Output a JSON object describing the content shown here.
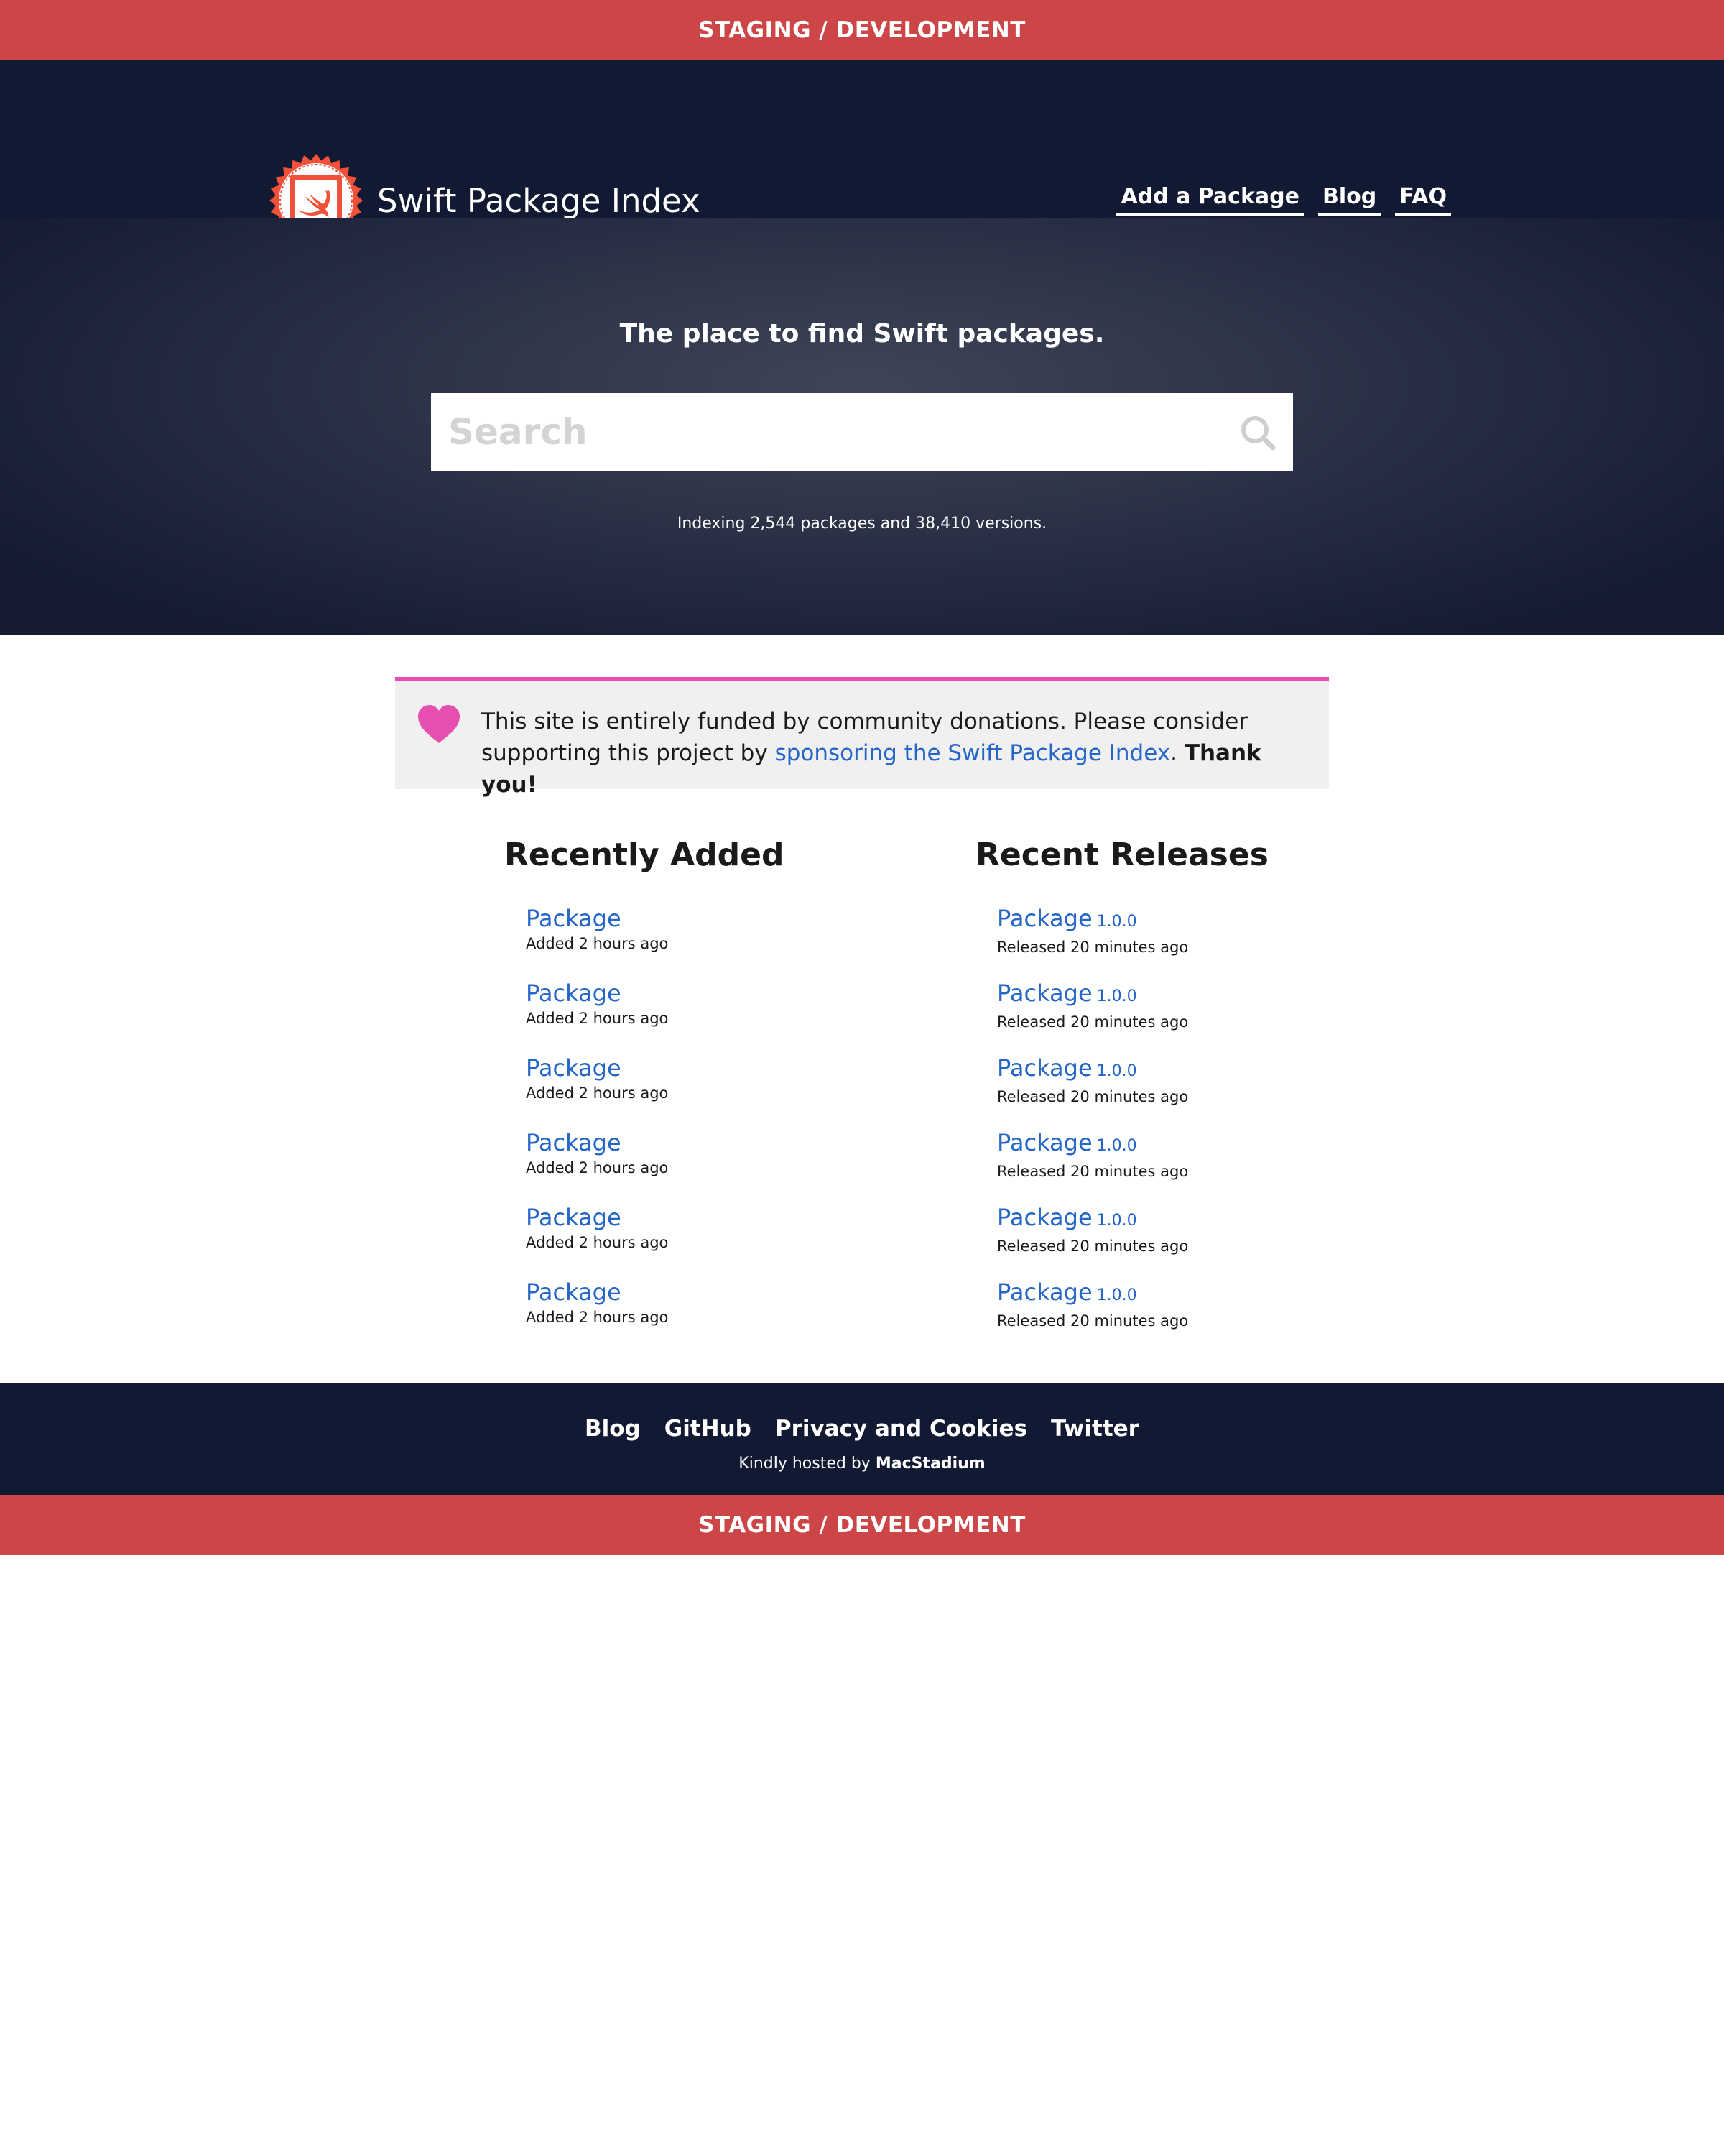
{
  "staging_banner": "STAGING / DEVELOPMENT",
  "header": {
    "site_title": "Swift Package Index",
    "nav": [
      "Add a Package",
      "Blog",
      "FAQ"
    ]
  },
  "hero": {
    "tagline": "The place to find Swift packages.",
    "search_placeholder": "Search",
    "stats": "Indexing 2,544 packages and 38,410 versions."
  },
  "donation": {
    "text_before": "This site is entirely funded by community donations. Please consider supporting this project by ",
    "link_text": "sponsoring the Swift Package Index",
    "text_after": ". ",
    "thanks": "Thank you!"
  },
  "recently_added": {
    "title": "Recently Added",
    "items": [
      {
        "name": "Package",
        "meta": "Added 2 hours ago"
      },
      {
        "name": "Package",
        "meta": "Added 2 hours ago"
      },
      {
        "name": "Package",
        "meta": "Added 2 hours ago"
      },
      {
        "name": "Package",
        "meta": "Added 2 hours ago"
      },
      {
        "name": "Package",
        "meta": "Added 2 hours ago"
      },
      {
        "name": "Package",
        "meta": "Added 2 hours ago"
      }
    ]
  },
  "recent_releases": {
    "title": "Recent Releases",
    "items": [
      {
        "name": "Package",
        "version": "1.0.0",
        "meta": "Released 20 minutes ago"
      },
      {
        "name": "Package",
        "version": "1.0.0",
        "meta": "Released 20 minutes ago"
      },
      {
        "name": "Package",
        "version": "1.0.0",
        "meta": "Released 20 minutes ago"
      },
      {
        "name": "Package",
        "version": "1.0.0",
        "meta": "Released 20 minutes ago"
      },
      {
        "name": "Package",
        "version": "1.0.0",
        "meta": "Released 20 minutes ago"
      },
      {
        "name": "Package",
        "version": "1.0.0",
        "meta": "Released 20 minutes ago"
      }
    ]
  },
  "footer": {
    "links": [
      "Blog",
      "GitHub",
      "Privacy and Cookies",
      "Twitter"
    ],
    "hosted_prefix": "Kindly hosted by ",
    "hosted_by": "MacStadium"
  },
  "colors": {
    "staging_red": "#cc4648",
    "header_navy": "#121a33",
    "link_blue": "#2566c8",
    "heart_pink": "#e64fb0",
    "logo_orange": "#f05138"
  },
  "icons": {
    "logo": "swift-bird-badge-icon",
    "search": "search-icon",
    "heart": "heart-icon"
  }
}
